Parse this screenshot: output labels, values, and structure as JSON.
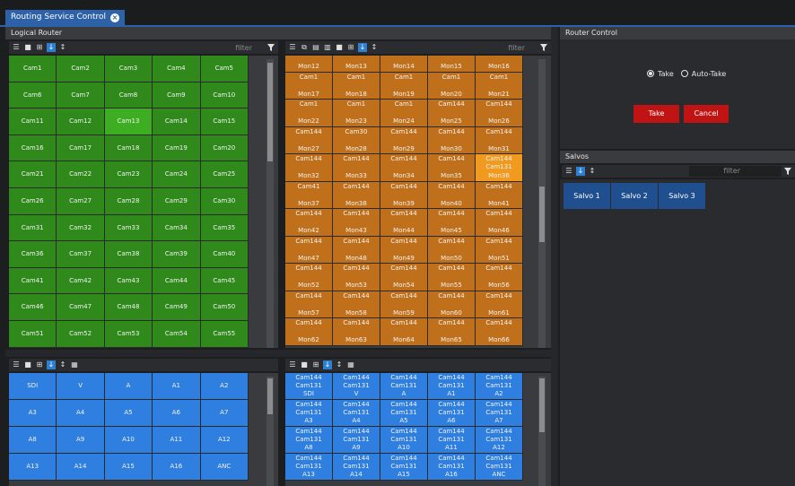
{
  "window": {
    "tab_title": "Routing Service Control",
    "tab_close_icon": "close-icon"
  },
  "logical_router": {
    "title": "Logical Router",
    "filter_placeholder": "filter",
    "sources": [
      "Cam1",
      "Cam2",
      "Cam3",
      "Cam4",
      "Cam5",
      "Cam6",
      "Cam7",
      "Cam8",
      "Cam9",
      "Cam10",
      "Cam11",
      "Cam12",
      "Cam13",
      "Cam14",
      "Cam15",
      "Cam16",
      "Cam17",
      "Cam18",
      "Cam19",
      "Cam20",
      "Cam21",
      "Cam22",
      "Cam23",
      "Cam24",
      "Cam25",
      "Cam26",
      "Cam27",
      "Cam28",
      "Cam29",
      "Cam30",
      "Cam31",
      "Cam32",
      "Cam33",
      "Cam34",
      "Cam35",
      "Cam36",
      "Cam37",
      "Cam38",
      "Cam39",
      "Cam40",
      "Cam41",
      "Cam42",
      "Cam43",
      "Cam44",
      "Cam45",
      "Cam46",
      "Cam47",
      "Cam48",
      "Cam49",
      "Cam50",
      "Cam51",
      "Cam52",
      "Cam53",
      "Cam54",
      "Cam55"
    ],
    "selected_source": "Cam13",
    "destinations": [
      {
        "src": "Cam3",
        "dst": "Mon12"
      },
      {
        "src": "Cam4",
        "dst": "Mon13"
      },
      {
        "src": "Cam5",
        "dst": "Mon14"
      },
      {
        "src": "Cam6",
        "dst": "Mon15"
      },
      {
        "src": "Cam7",
        "dst": "Mon16"
      },
      {
        "src": "Cam1",
        "dst": "Mon17"
      },
      {
        "src": "Cam1",
        "dst": "Mon18"
      },
      {
        "src": "Cam1",
        "dst": "Mon19"
      },
      {
        "src": "Cam1",
        "dst": "Mon20"
      },
      {
        "src": "Cam1",
        "dst": "Mon21"
      },
      {
        "src": "Cam1",
        "dst": "Mon22"
      },
      {
        "src": "Cam1",
        "dst": "Mon23"
      },
      {
        "src": "Cam1",
        "dst": "Mon24"
      },
      {
        "src": "Cam144",
        "dst": "Mon25"
      },
      {
        "src": "Cam144",
        "dst": "Mon26"
      },
      {
        "src": "Cam144",
        "dst": "Mon27"
      },
      {
        "src": "Cam30",
        "dst": "Mon28"
      },
      {
        "src": "Cam144",
        "dst": "Mon29"
      },
      {
        "src": "Cam144",
        "dst": "Mon30"
      },
      {
        "src": "Cam144",
        "dst": "Mon31"
      },
      {
        "src": "Cam144",
        "dst": "Mon32"
      },
      {
        "src": "Cam144",
        "dst": "Mon33"
      },
      {
        "src": "Cam144",
        "dst": "Mon34"
      },
      {
        "src": "Cam144",
        "dst": "Mon35"
      },
      {
        "src": "Cam144",
        "src2": "Cam131",
        "dst": "Mon36"
      },
      {
        "src": "Cam41",
        "dst": "Mon37"
      },
      {
        "src": "Cam144",
        "dst": "Mon38"
      },
      {
        "src": "Cam144",
        "dst": "Mon39"
      },
      {
        "src": "Cam144",
        "dst": "Mon40"
      },
      {
        "src": "Cam144",
        "dst": "Mon41"
      },
      {
        "src": "Cam144",
        "dst": "Mon42"
      },
      {
        "src": "Cam144",
        "dst": "Mon43"
      },
      {
        "src": "Cam144",
        "dst": "Mon44"
      },
      {
        "src": "Cam144",
        "dst": "Mon45"
      },
      {
        "src": "Cam144",
        "dst": "Mon46"
      },
      {
        "src": "Cam144",
        "dst": "Mon47"
      },
      {
        "src": "Cam144",
        "dst": "Mon48"
      },
      {
        "src": "Cam144",
        "dst": "Mon49"
      },
      {
        "src": "Cam144",
        "dst": "Mon50"
      },
      {
        "src": "Cam144",
        "dst": "Mon51"
      },
      {
        "src": "Cam144",
        "dst": "Mon52"
      },
      {
        "src": "Cam144",
        "dst": "Mon53"
      },
      {
        "src": "Cam144",
        "dst": "Mon54"
      },
      {
        "src": "Cam144",
        "dst": "Mon55"
      },
      {
        "src": "Cam144",
        "dst": "Mon56"
      },
      {
        "src": "Cam144",
        "dst": "Mon57"
      },
      {
        "src": "Cam144",
        "dst": "Mon58"
      },
      {
        "src": "Cam144",
        "dst": "Mon59"
      },
      {
        "src": "Cam144",
        "dst": "Mon60"
      },
      {
        "src": "Cam144",
        "dst": "Mon61"
      },
      {
        "src": "Cam144",
        "dst": "Mon62"
      },
      {
        "src": "Cam144",
        "dst": "Mon63"
      },
      {
        "src": "Cam144",
        "dst": "Mon64"
      },
      {
        "src": "Cam144",
        "dst": "Mon65"
      },
      {
        "src": "Cam144",
        "dst": "Mon66"
      }
    ],
    "highlighted_destination": "Mon36",
    "audio_sources": [
      "SDI",
      "V",
      "A",
      "A1",
      "A2",
      "A3",
      "A4",
      "A5",
      "A6",
      "A7",
      "A8",
      "A9",
      "A10",
      "A11",
      "A12",
      "A13",
      "A14",
      "A15",
      "A16",
      "ANC"
    ],
    "audio_destinations": [
      {
        "l1": "Cam144",
        "l2": "Cam131",
        "l3": "SDI"
      },
      {
        "l1": "Cam144",
        "l2": "Cam131",
        "l3": "V"
      },
      {
        "l1": "Cam144",
        "l2": "Cam131",
        "l3": "A"
      },
      {
        "l1": "Cam144",
        "l2": "Cam131",
        "l3": "A1"
      },
      {
        "l1": "Cam144",
        "l2": "Cam131",
        "l3": "A2"
      },
      {
        "l1": "Cam144",
        "l2": "Cam131",
        "l3": "A3"
      },
      {
        "l1": "Cam144",
        "l2": "Cam131",
        "l3": "A4"
      },
      {
        "l1": "Cam144",
        "l2": "Cam131",
        "l3": "A5"
      },
      {
        "l1": "Cam144",
        "l2": "Cam131",
        "l3": "A6"
      },
      {
        "l1": "Cam144",
        "l2": "Cam131",
        "l3": "A7"
      },
      {
        "l1": "Cam144",
        "l2": "Cam131",
        "l3": "A8"
      },
      {
        "l1": "Cam144",
        "l2": "Cam131",
        "l3": "A9"
      },
      {
        "l1": "Cam144",
        "l2": "Cam131",
        "l3": "A10"
      },
      {
        "l1": "Cam144",
        "l2": "Cam131",
        "l3": "A11"
      },
      {
        "l1": "Cam144",
        "l2": "Cam131",
        "l3": "A12"
      },
      {
        "l1": "Cam144",
        "l2": "Cam131",
        "l3": "A13"
      },
      {
        "l1": "Cam144",
        "l2": "Cam131",
        "l3": "A14"
      },
      {
        "l1": "Cam144",
        "l2": "Cam131",
        "l3": "A15"
      },
      {
        "l1": "Cam144",
        "l2": "Cam131",
        "l3": "A16"
      },
      {
        "l1": "Cam144",
        "l2": "Cam131",
        "l3": "ANC"
      }
    ]
  },
  "router_control": {
    "title": "Router Control",
    "take_radio_label": "Take",
    "auto_take_radio_label": "Auto-Take",
    "selected_mode": "Take",
    "take_button": "Take",
    "cancel_button": "Cancel"
  },
  "salvos": {
    "title": "Salvos",
    "filter_placeholder": "filter",
    "items": [
      "Salvo 1",
      "Salvo 2",
      "Salvo 3"
    ]
  },
  "colors": {
    "source_green": "#2f8a1b",
    "selected_green": "#3dad22",
    "destination_orange": "#c0701a",
    "highlight_orange": "#f09a1f",
    "audio_blue": "#2f7fe0",
    "salvo_blue": "#1f4f8e",
    "button_red": "#c01414",
    "tab_blue": "#2d61a8"
  }
}
